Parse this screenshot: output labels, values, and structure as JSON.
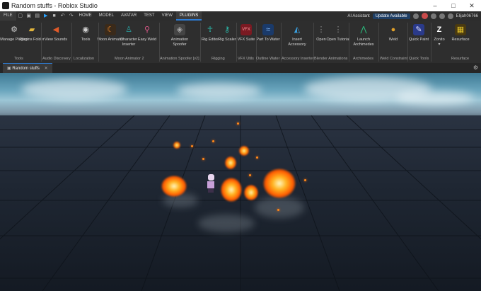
{
  "window": {
    "title": "Random stuffs - Roblox Studio",
    "controls": [
      "–",
      "□",
      "✕"
    ]
  },
  "menubar": {
    "file": "FILE",
    "tabs": [
      "HOME",
      "MODEL",
      "AVATAR",
      "TEST",
      "VIEW",
      "PLUGINS"
    ],
    "active_tab": "PLUGINS",
    "ai_assistant": "AI Assistant",
    "update": "Update Available",
    "username": "Elijah06766"
  },
  "ribbon": {
    "buttons": [
      {
        "label": "Manage Plugins",
        "icon": "gear-plug-icon",
        "color": "#d0d0d0"
      },
      {
        "label": "Plugins Folder",
        "icon": "folder-icon",
        "color": "#e0b43c"
      },
      {
        "label": "View Sounds",
        "icon": "speaker-icon",
        "color": "#e05a2a"
      },
      {
        "label": "Tools",
        "icon": "globe-icon",
        "color": "#d0d0d0"
      },
      {
        "label": "Moon Animator",
        "icon": "moon-icon",
        "color": "#f08a2a"
      },
      {
        "label": "Character Inserter",
        "icon": "character-icon",
        "color": "#2aa3a3"
      },
      {
        "label": "Easy Weld",
        "icon": "weld-icon",
        "color": "#e05a8a"
      },
      {
        "label": "Animation Spoofer",
        "icon": "spoofer-icon",
        "color": "#444"
      },
      {
        "label": "Rig Editor",
        "icon": "rig-icon",
        "color": "#2ac0b0"
      },
      {
        "label": "Rig Scaler",
        "icon": "scaler-icon",
        "color": "#2ac0b0"
      },
      {
        "label": "VFX Suite",
        "icon": "vfx-icon",
        "color": "#c02a3a"
      },
      {
        "label": "Part To Water",
        "icon": "water-icon",
        "color": "#2a6ac0"
      },
      {
        "label": "Insert Accessory",
        "icon": "accessory-icon",
        "color": "#3aa0e0"
      },
      {
        "label": "Open",
        "icon": "blender-icon",
        "color": "#555"
      },
      {
        "label": "Open Tutorial",
        "icon": "blender-tutorial-icon",
        "color": "#555"
      },
      {
        "label": "Launch Archimedes",
        "icon": "archimedes-icon",
        "color": "#2ac080"
      },
      {
        "label": "Weld",
        "icon": "weld-ball-icon",
        "color": "#e0a02a"
      },
      {
        "label": "Quick Paint",
        "icon": "paint-icon",
        "color": "#3a5ac0"
      },
      {
        "label": "Zonito",
        "icon": "zonito-icon",
        "color": "#ffffff"
      },
      {
        "label": "Resurface",
        "icon": "resurface-icon",
        "color": "#e0c02a"
      }
    ],
    "groups": [
      "Tools",
      "Audio Discovery",
      "Localization",
      "Moon Animator 2",
      "Animation Spoofer [v2]",
      "Rigging",
      "VFX Utils",
      "Outline Water",
      "Accessory Inserter",
      "Blender Animations",
      "Archimedes",
      "Weld Constraint",
      "Quick Tools",
      "Resurface"
    ]
  },
  "document_tab": {
    "label": "Random stuffs",
    "close": "✕"
  }
}
